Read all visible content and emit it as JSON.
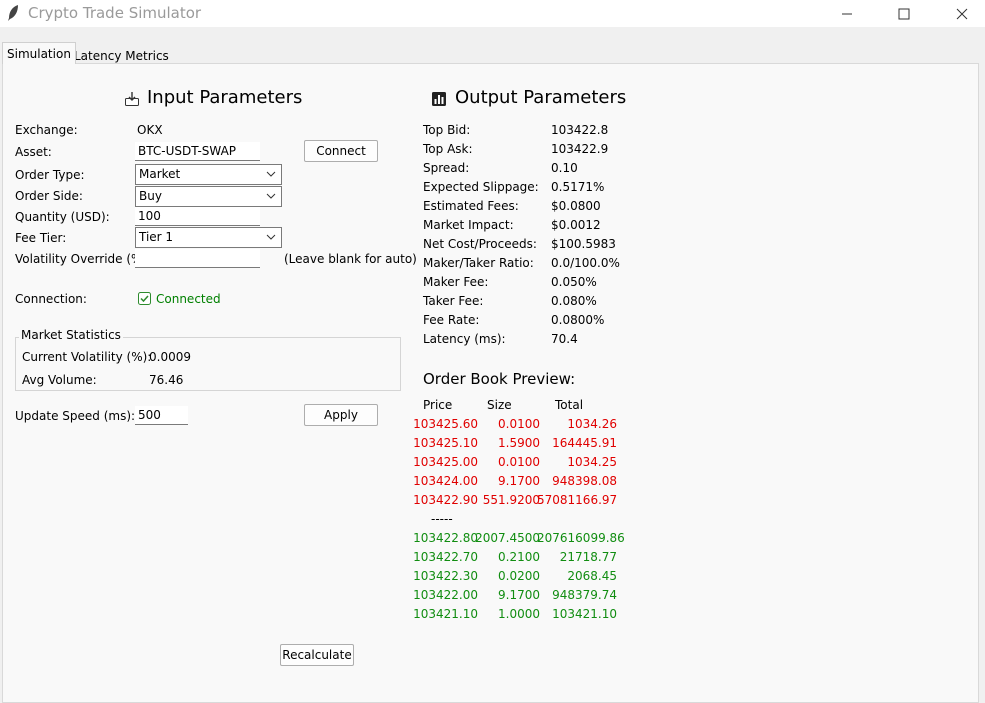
{
  "window": {
    "title": "Crypto Trade Simulator"
  },
  "tabs": [
    {
      "label": "Simulation"
    },
    {
      "label": "Latency Metrics"
    }
  ],
  "input_section": {
    "heading": "Input Parameters",
    "exchange_label": "Exchange:",
    "exchange_value": "OKX",
    "asset_label": "Asset:",
    "asset_value": "BTC-USDT-SWAP",
    "connect_label": "Connect",
    "order_type_label": "Order Type:",
    "order_type_value": "Market",
    "order_side_label": "Order Side:",
    "order_side_value": "Buy",
    "quantity_label": "Quantity (USD):",
    "quantity_value": "100",
    "fee_tier_label": "Fee Tier:",
    "fee_tier_value": "Tier 1",
    "volatility_label": "Volatility Override (%):",
    "volatility_value": "",
    "volatility_hint": "(Leave blank for auto)",
    "connection_label": "Connection:",
    "connection_status": "Connected",
    "market_stats_title": "Market Statistics",
    "current_volatility_label": "Current Volatility (%):",
    "current_volatility_value": "0.0009",
    "avg_volume_label": "Avg Volume:",
    "avg_volume_value": "76.46",
    "update_speed_label": "Update Speed (ms):",
    "update_speed_value": "500",
    "apply_label": "Apply",
    "recalculate_label": "Recalculate"
  },
  "output_section": {
    "heading": "Output Parameters",
    "rows": [
      {
        "label": "Top Bid:",
        "value": "103422.8"
      },
      {
        "label": "Top Ask:",
        "value": "103422.9"
      },
      {
        "label": "Spread:",
        "value": "0.10"
      },
      {
        "label": "Expected Slippage:",
        "value": "0.5171%"
      },
      {
        "label": "Estimated Fees:",
        "value": "$0.0800"
      },
      {
        "label": "Market Impact:",
        "value": "$0.0012"
      },
      {
        "label": "Net Cost/Proceeds:",
        "value": "$100.5983"
      },
      {
        "label": "Maker/Taker Ratio:",
        "value": "0.0/100.0%"
      },
      {
        "label": "Maker Fee:",
        "value": "0.050%"
      },
      {
        "label": "Taker Fee:",
        "value": "0.080%"
      },
      {
        "label": "Fee Rate:",
        "value": "0.0800%"
      },
      {
        "label": "Latency (ms):",
        "value": "70.4"
      }
    ]
  },
  "order_book": {
    "title": "Order Book Preview:",
    "headers": {
      "price": "Price",
      "size": "Size",
      "total": "Total"
    },
    "asks": [
      {
        "price": "103425.60",
        "size": "0.0100",
        "total": "1034.26"
      },
      {
        "price": "103425.10",
        "size": "1.5900",
        "total": "164445.91"
      },
      {
        "price": "103425.00",
        "size": "0.0100",
        "total": "1034.25"
      },
      {
        "price": "103424.00",
        "size": "9.1700",
        "total": "948398.08"
      },
      {
        "price": "103422.90",
        "size": "551.9200",
        "total": "57081166.97"
      }
    ],
    "separator": "-----",
    "bids": [
      {
        "price": "103422.80",
        "size": "2007.4500",
        "total": "207616099.86"
      },
      {
        "price": "103422.70",
        "size": "0.2100",
        "total": "21718.77"
      },
      {
        "price": "103422.30",
        "size": "0.0200",
        "total": "2068.45"
      },
      {
        "price": "103422.00",
        "size": "9.1700",
        "total": "948379.74"
      },
      {
        "price": "103421.10",
        "size": "1.0000",
        "total": "103421.10"
      }
    ],
    "ask_color": "#e00000",
    "bid_color": "#118d11"
  }
}
